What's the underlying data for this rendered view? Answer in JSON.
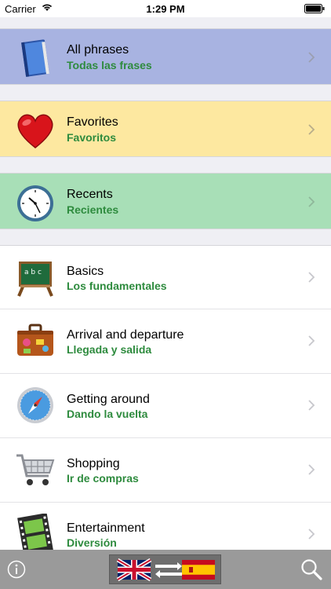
{
  "status_bar": {
    "carrier": "Carrier",
    "time": "1:29 PM"
  },
  "sections": [
    {
      "id": "all",
      "title": "All phrases",
      "subtitle": "Todas las frases",
      "icon": "book-icon",
      "bg": "#a8b3e1"
    },
    {
      "id": "fav",
      "title": "Favorites",
      "subtitle": "Favoritos",
      "icon": "heart-icon",
      "bg": "#fde8a0"
    },
    {
      "id": "rec",
      "title": "Recents",
      "subtitle": "Recientes",
      "icon": "clock-icon",
      "bg": "#a8dfb7"
    }
  ],
  "categories": [
    {
      "title": "Basics",
      "subtitle": "Los fundamentales",
      "icon": "chalkboard-icon"
    },
    {
      "title": "Arrival and departure",
      "subtitle": "Llegada y salida",
      "icon": "suitcase-icon"
    },
    {
      "title": "Getting around",
      "subtitle": "Dando la vuelta",
      "icon": "compass-icon"
    },
    {
      "title": "Shopping",
      "subtitle": "Ir de compras",
      "icon": "cart-icon"
    },
    {
      "title": "Entertainment",
      "subtitle": "Diversión",
      "icon": "film-icon"
    }
  ],
  "colors": {
    "subtitle": "#2e8b3e",
    "toolbar": "#9a9a9a"
  },
  "toolbar": {
    "info_icon": "info-icon",
    "language_switch": "uk-to-spain-flags",
    "search_icon": "search-icon"
  }
}
